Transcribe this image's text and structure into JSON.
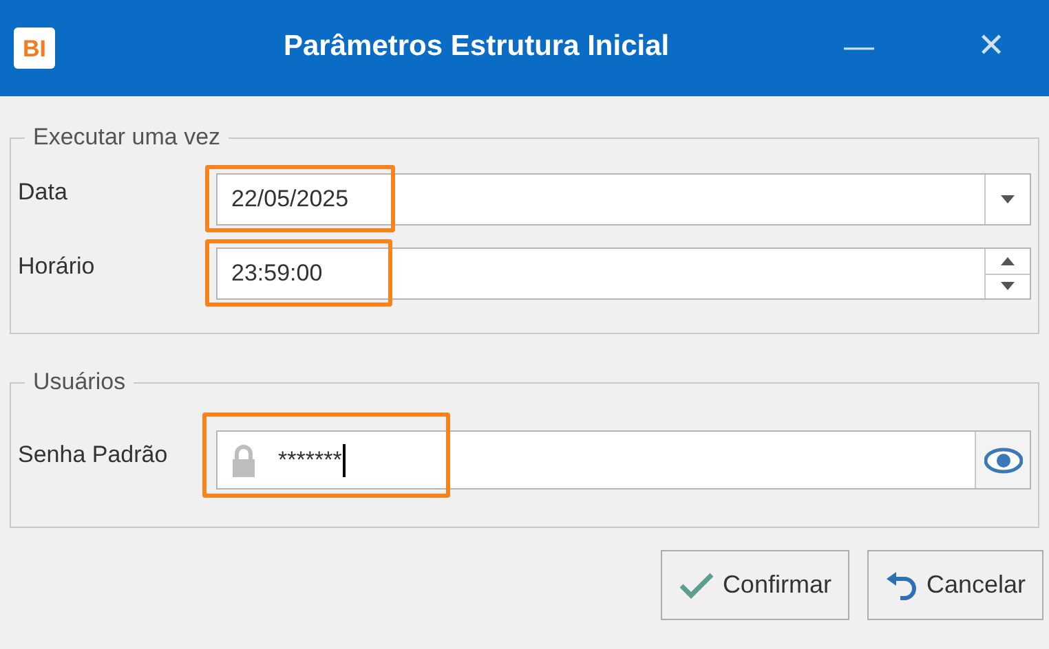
{
  "window": {
    "logo": "BI",
    "title": "Parâmetros Estrutura Inicial",
    "minimize": "—",
    "close": "✕"
  },
  "groups": [
    {
      "title": "Executar uma vez",
      "fields": [
        {
          "label": "Data",
          "value": "22/05/2025",
          "kind": "dropdown",
          "highlighted": true
        },
        {
          "label": "Horário",
          "value": "23:59:00",
          "kind": "spin",
          "highlighted": true
        }
      ]
    },
    {
      "title": "Usuários",
      "fields": [
        {
          "label": "Senha Padrão",
          "value": "*******",
          "kind": "password",
          "highlighted": true
        }
      ]
    }
  ],
  "buttons": [
    {
      "label": "Confirmar",
      "kind": "confirm"
    },
    {
      "label": "Cancelar",
      "kind": "cancel"
    }
  ]
}
